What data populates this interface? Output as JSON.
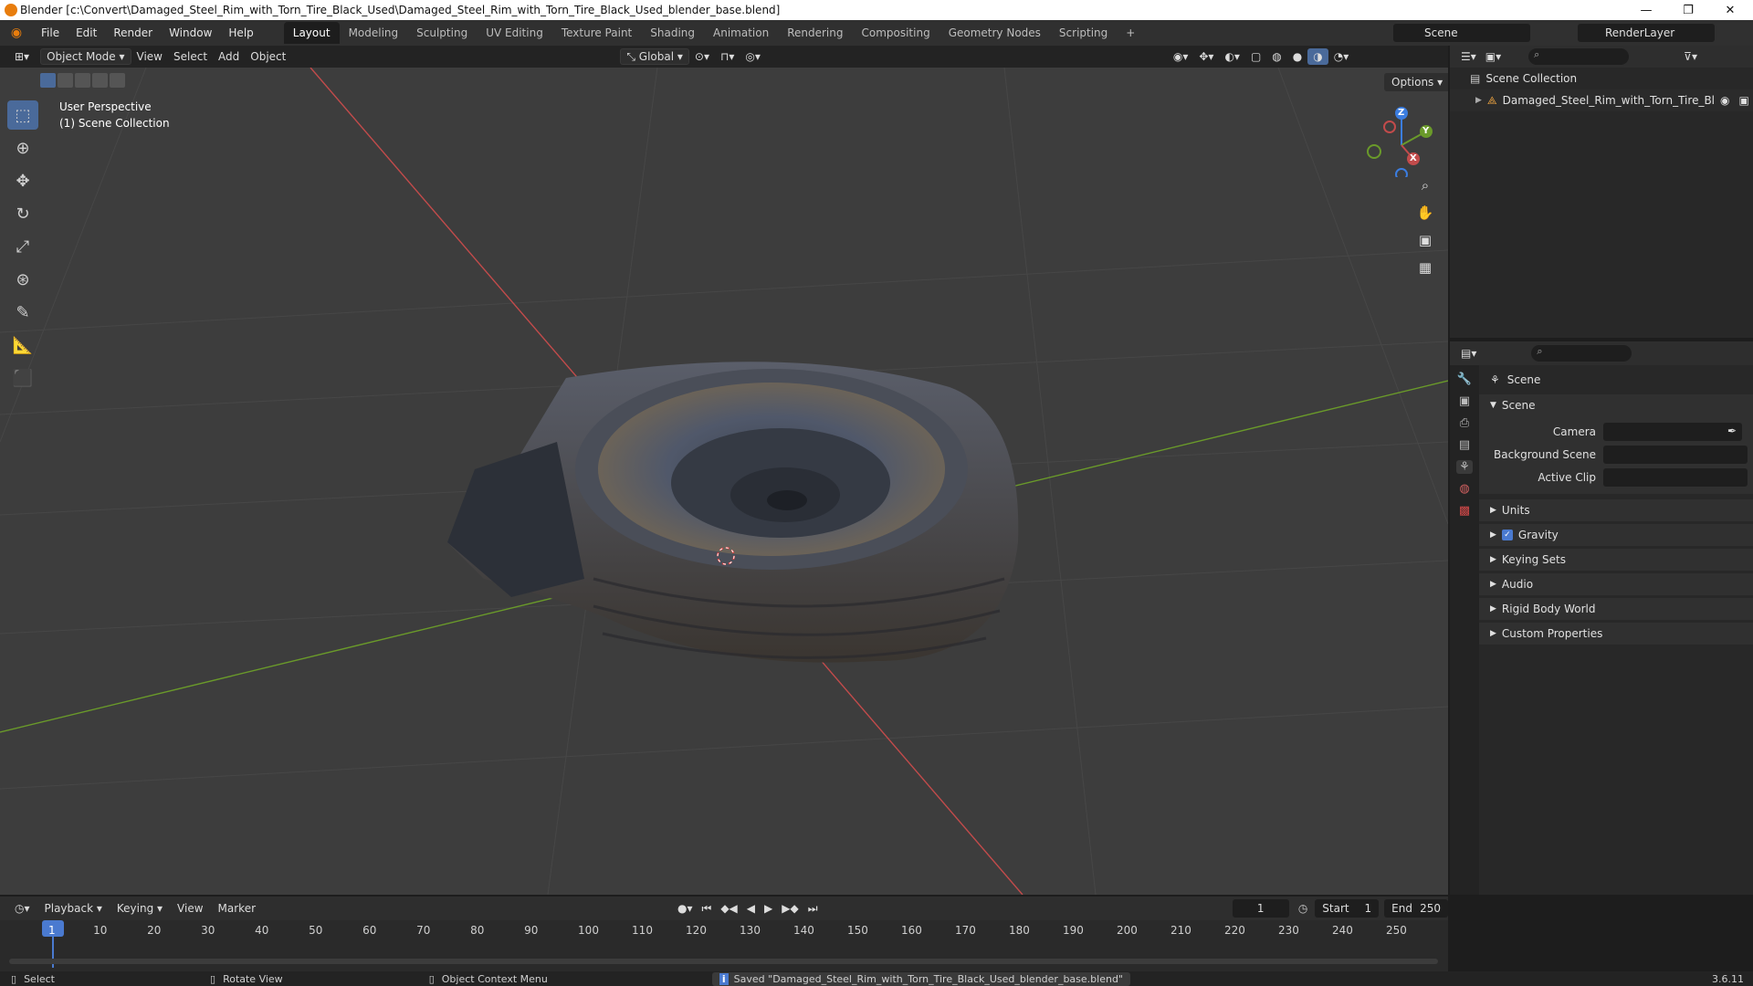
{
  "window": {
    "title": "Blender [c:\\Convert\\Damaged_Steel_Rim_with_Torn_Tire_Black_Used\\Damaged_Steel_Rim_with_Torn_Tire_Black_Used_blender_base.blend]"
  },
  "menus": [
    "File",
    "Edit",
    "Render",
    "Window",
    "Help"
  ],
  "workspaces": [
    "Layout",
    "Modeling",
    "Sculpting",
    "UV Editing",
    "Texture Paint",
    "Shading",
    "Animation",
    "Rendering",
    "Compositing",
    "Geometry Nodes",
    "Scripting"
  ],
  "active_workspace": "Layout",
  "scene_field": "Scene",
  "renderlayer_field": "RenderLayer",
  "viewport_header": {
    "mode": "Object Mode",
    "view": "View",
    "select": "Select",
    "add": "Add",
    "object": "Object",
    "transform": "Global",
    "options": "Options"
  },
  "viewport": {
    "perspective": "User Perspective",
    "collection": "(1) Scene Collection"
  },
  "gizmo": {
    "z": "Z",
    "y": "Y",
    "x": "X"
  },
  "outliner": {
    "root": "Scene Collection",
    "item": "Damaged_Steel_Rim_with_Torn_Tire_Bl"
  },
  "properties": {
    "header": "Scene",
    "section": "Scene",
    "fields": [
      {
        "label": "Camera"
      },
      {
        "label": "Background Scene"
      },
      {
        "label": "Active Clip"
      }
    ],
    "panels": [
      "Units",
      "Gravity",
      "Keying Sets",
      "Audio",
      "Rigid Body World",
      "Custom Properties"
    ],
    "gravity_checked": true
  },
  "timeline": {
    "playback": "Playback",
    "keying": "Keying",
    "view": "View",
    "marker": "Marker",
    "current_frame": "1",
    "start_label": "Start",
    "start": "1",
    "end_label": "End",
    "end": "250",
    "ticks": [
      "1",
      "10",
      "20",
      "30",
      "40",
      "50",
      "60",
      "70",
      "80",
      "90",
      "100",
      "110",
      "120",
      "130",
      "140",
      "150",
      "160",
      "170",
      "180",
      "190",
      "200",
      "210",
      "220",
      "230",
      "240",
      "250"
    ]
  },
  "status": {
    "select": "Select",
    "rotate": "Rotate View",
    "context": "Object Context Menu",
    "message": "Saved \"Damaged_Steel_Rim_with_Torn_Tire_Black_Used_blender_base.blend\"",
    "version": "3.6.11"
  },
  "colors": {
    "x_axis": "#c24b4b",
    "y_axis": "#6a9a2a",
    "accent": "#4a6a9a"
  }
}
